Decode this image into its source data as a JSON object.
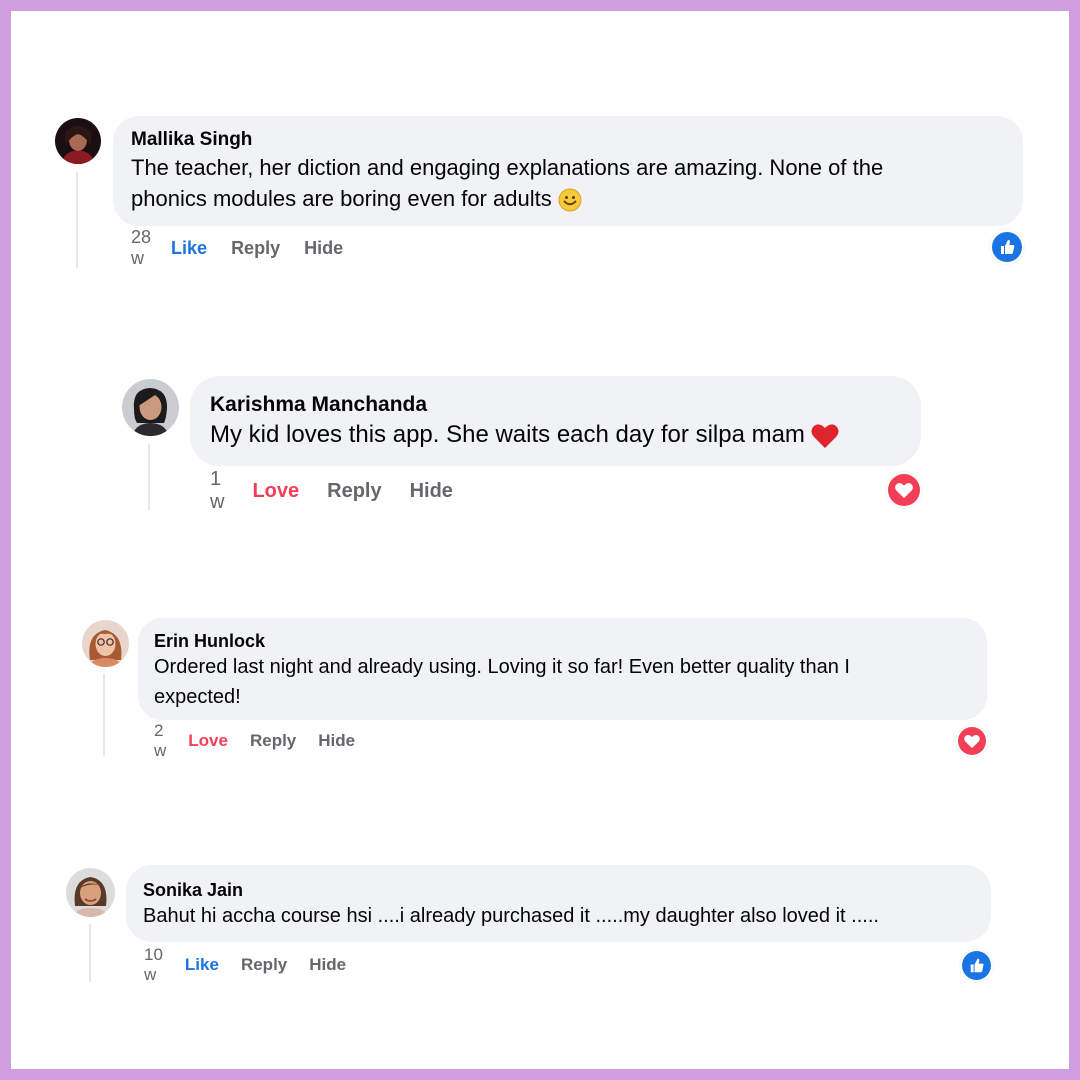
{
  "comments": [
    {
      "author": "Mallika Singh",
      "text": "The teacher, her diction and engaging explanations are amazing. None of the phonics modules are boring even for adults",
      "emoji": "smile-emoji",
      "time": "28 w",
      "reaction_label": "Like",
      "reply_label": "Reply",
      "hide_label": "Hide",
      "reaction_icon": "like-icon"
    },
    {
      "author": "Karishma Manchanda",
      "text": "My kid loves this app. She waits each day for silpa mam",
      "emoji": "heart-emoji",
      "time": "1 w",
      "reaction_label": "Love",
      "reply_label": "Reply",
      "hide_label": "Hide",
      "reaction_icon": "love-icon"
    },
    {
      "author": "Erin Hunlock",
      "text": "Ordered last night and already using. Loving it so far! Even better quality than I expected!",
      "time": "2 w",
      "reaction_label": "Love",
      "reply_label": "Reply",
      "hide_label": "Hide",
      "reaction_icon": "love-icon"
    },
    {
      "author": "Sonika Jain",
      "text": "Bahut hi accha course hsi ....i already purchased it .....my daughter also loved it .....",
      "time": "10 w",
      "reaction_label": "Like",
      "reply_label": "Reply",
      "hide_label": "Hide",
      "reaction_icon": "like-icon"
    }
  ],
  "colors": {
    "frame": "#cf9ede",
    "bubble": "#f0f2f5",
    "like_blue": "#1b74e4",
    "love_red": "#f33e58",
    "meta_grey": "#65676b"
  }
}
